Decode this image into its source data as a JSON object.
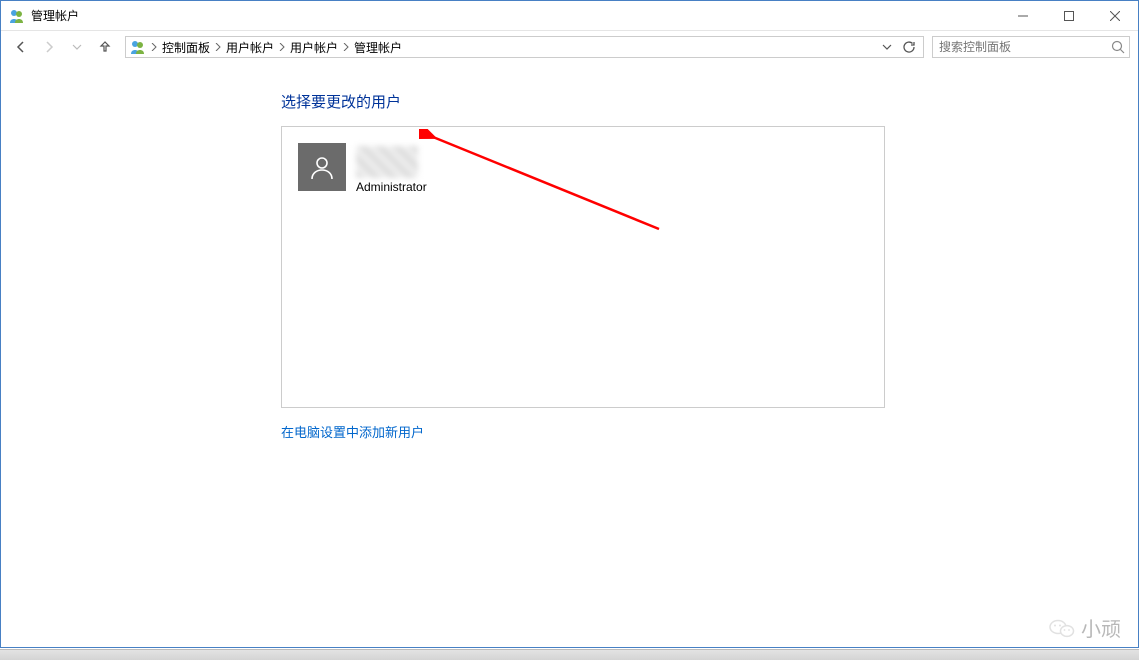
{
  "titlebar": {
    "title": "管理帐户"
  },
  "breadcrumb": {
    "items": [
      "控制面板",
      "用户帐户",
      "用户帐户",
      "管理帐户"
    ]
  },
  "search": {
    "placeholder": "搜索控制面板"
  },
  "heading": "选择要更改的用户",
  "user": {
    "role": "Administrator"
  },
  "add_user_link": "在电脑设置中添加新用户",
  "watermark": {
    "text": "小顽"
  }
}
